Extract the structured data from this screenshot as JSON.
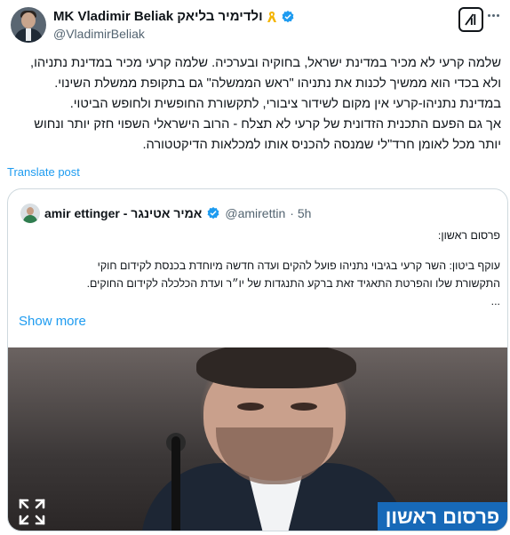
{
  "author": {
    "name": "MK Vladimir Beliak ולדימיר בליאק",
    "handle": "@VladimirBeliak"
  },
  "post": {
    "lines": [
      "שלמה קרעי לא מכיר במדינת ישראל, בחוקיה ובערכיה. שלמה קרעי מכיר במדינת נתניהו,",
      "ולא בכדי הוא ממשיך לכנות את נתניהו \"ראש הממשלה\" גם בתקופת ממשלת השינוי.",
      "במדינת נתניהו-קרעי אין מקום לשידור ציבורי, לתקשורת החופשית ולחופש הביטוי.",
      "אך גם הפעם התכנית הזדונית של קרעי לא תצלח - הרוב הישראלי השפוי חזק יותר ונחוש",
      "יותר מכל לאומן חרד\"לי שמנסה להכניס אותו למכלאות הדיקטטורה."
    ],
    "translate_label": "Translate post"
  },
  "quote": {
    "name": "amir ettinger - אמיר אטינגר",
    "handle": "@amirettin",
    "time": "· 5h",
    "lines": [
      "פרסום ראשון:",
      "",
      "עוקף ביטון: השר קרעי בגיבוי נתניהו פועל להקים ועדה חדשה מיוחדת בכנסת לקידום חוקי",
      "התקשורת שלו והפרטת התאגיד זאת ברקע התנגדות של יו״ר ועדת הכלכלה לקידום החוקים.",
      "..."
    ],
    "show_more": "Show more",
    "image_banner": "פרסום ראשון"
  },
  "colors": {
    "link": "#1d9bf0",
    "verified": "#1d9bf0",
    "ribbon": "#f4b400",
    "banner": "#1769b8"
  },
  "icons": [
    "yellow-ribbon-icon",
    "verified-badge-icon",
    "grok-icon",
    "more-options-icon",
    "expand-icon"
  ]
}
